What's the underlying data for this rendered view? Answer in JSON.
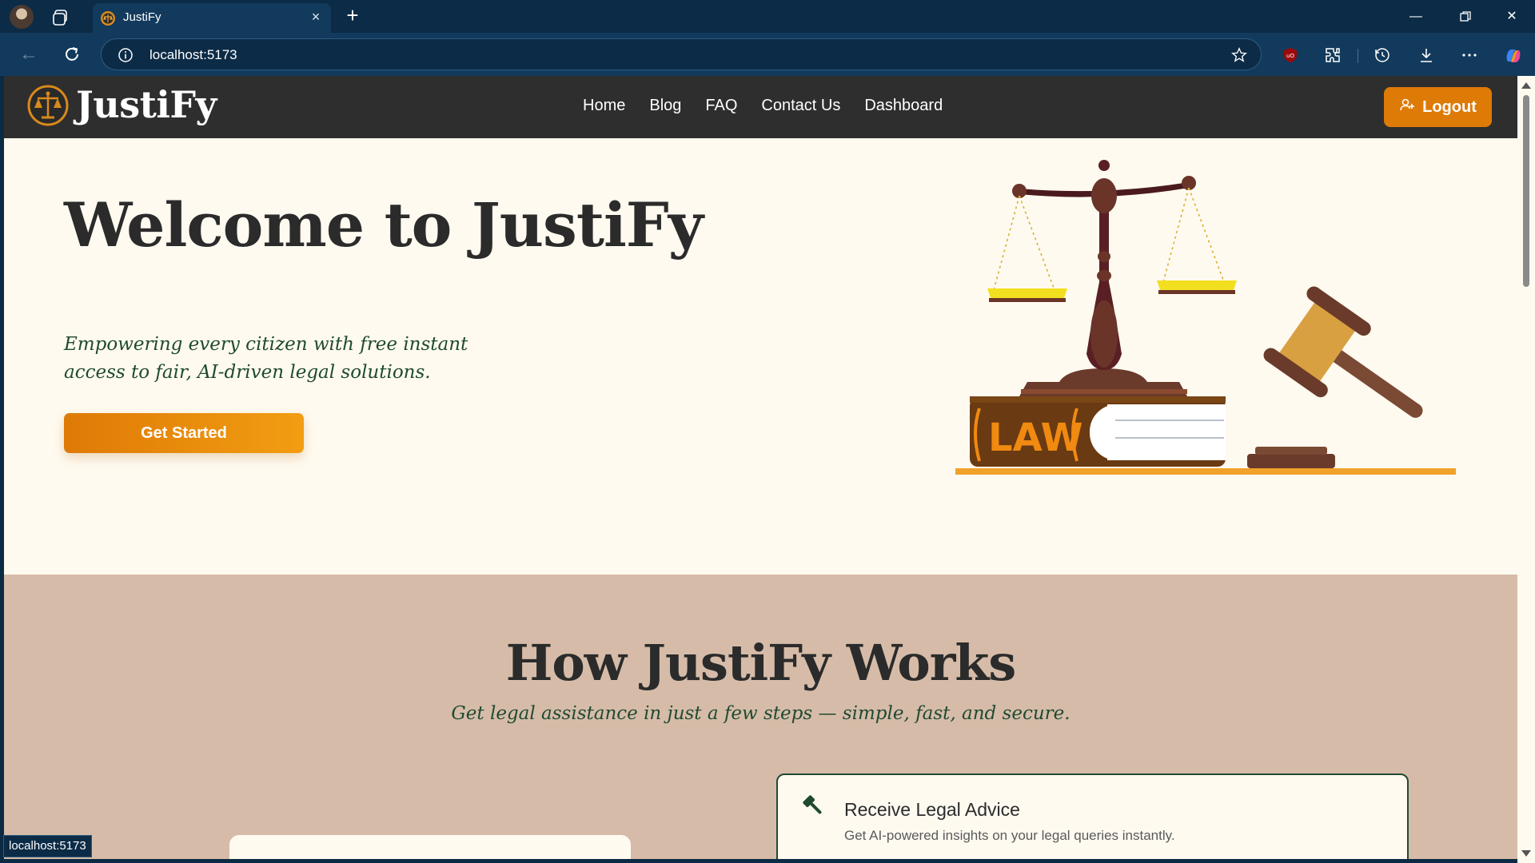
{
  "browser": {
    "tab_title": "JustiFy",
    "url": "localhost:5173",
    "status_url": "localhost:5173",
    "icons": [
      "profile-avatar",
      "collections-icon",
      "close-icon",
      "plus-icon",
      "back-icon",
      "reload-icon",
      "info-icon",
      "star-icon",
      "ublock-icon",
      "extensions-icon",
      "history-icon",
      "download-icon",
      "more-icon",
      "copilot-icon",
      "minimize-icon",
      "restore-icon",
      "close-window-icon"
    ]
  },
  "app": {
    "brand": "JustiFy",
    "nav_links": [
      "Home",
      "Blog",
      "FAQ",
      "Contact Us",
      "Dashboard"
    ],
    "logout_label": "Logout",
    "colors": {
      "nav_bg": "#2e2e2e",
      "accent": "#de7a06",
      "hero_bg": "#fffaf0",
      "section_bg": "#d6bca8",
      "green_text": "#1f4a32"
    }
  },
  "hero": {
    "title": "Welcome to JustiFy",
    "tagline": "Empowering every citizen with free instant access to fair, AI-driven legal solutions.",
    "cta_label": "Get Started",
    "art_book_label": "LAW"
  },
  "how": {
    "title": "How JustiFy Works",
    "subtitle": "Get legal assistance in just a few steps — simple, fast, and secure.",
    "steps": [
      {
        "title": "Receive Legal Advice",
        "desc": "Get AI-powered insights on your legal queries instantly.",
        "icon": "gavel-icon"
      }
    ]
  }
}
